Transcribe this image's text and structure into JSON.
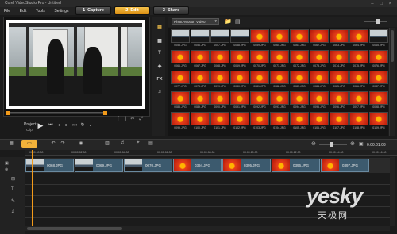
{
  "window": {
    "title": "Corel VideoStudio Pro - Untitled"
  },
  "menu": [
    "File",
    "Edit",
    "Tools",
    "Settings"
  ],
  "steps": [
    {
      "num": "1",
      "label": "Capture"
    },
    {
      "num": "2",
      "label": "Edit"
    },
    {
      "num": "3",
      "label": "Share"
    }
  ],
  "player": {
    "mode_label": "Project",
    "clip_label": "Clip"
  },
  "library": {
    "category": "Photo-Motion Video",
    "thumbnails": [
      "0055.JPG",
      "0056.JPG",
      "0057.JPG",
      "0058.JPG",
      "0059.JPG",
      "0060.JPG",
      "0061.JPG",
      "0062.JPG",
      "0063.JPG",
      "0064.JPG",
      "0065.JPG",
      "0066.JPG",
      "0067.JPG",
      "0068.JPG",
      "0069.JPG",
      "0070.JPG",
      "0071.JPG",
      "0072.JPG",
      "0073.JPG",
      "0074.JPG",
      "0075.JPG",
      "0076.JPG",
      "0077.JPG",
      "0078.JPG",
      "0079.JPG",
      "0080.JPG",
      "0081.JPG",
      "0082.JPG",
      "0083.JPG",
      "0084.JPG",
      "0085.JPG",
      "0086.JPG",
      "0087.JPG",
      "0088.JPG",
      "0089.JPG",
      "0090.JPG",
      "0091.JPG",
      "0092.JPG",
      "0093.JPG",
      "0094.JPG",
      "0095.JPG",
      "0096.JPG",
      "0097.JPG",
      "0098.JPG",
      "0099.JPG",
      "0100.JPG",
      "0101.JPG",
      "0102.JPG",
      "0103.JPG",
      "0104.JPG",
      "0105.JPG",
      "0106.JPG",
      "0107.JPG",
      "0108.JPG",
      "0109.JPG"
    ]
  },
  "timeline": {
    "timecode": "0:00:01:03",
    "ruler": [
      "00:00:00:00",
      "00:00:02:00",
      "00:00:04:00",
      "00:00:06:00",
      "00:00:08:00",
      "00:00:10:00",
      "00:00:12:00",
      "00:00:14:00",
      "00:00:16:00"
    ],
    "clips": [
      "0068.JPG",
      "0069.JPG",
      "0070.JPG",
      "0394.JPG",
      "0395.JPG",
      "0396.JPG",
      "0397.JPG"
    ]
  },
  "watermark": {
    "brand": "yesky",
    "sub": "天极网"
  },
  "colors": {
    "accent": "#f29a1a",
    "clip": "#3c5a6e",
    "background": "#1b1b1b"
  }
}
